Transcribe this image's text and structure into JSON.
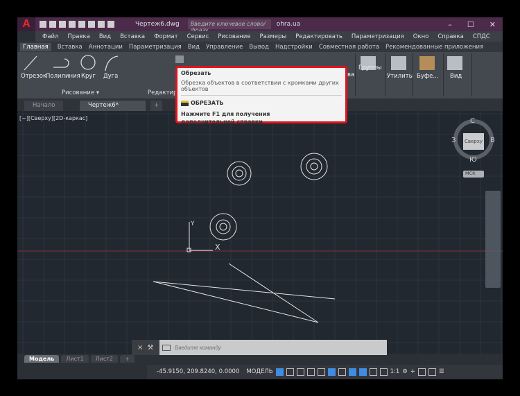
{
  "app": {
    "logo": "A",
    "document_title": "Чертеж6.dwg",
    "search_placeholder": "Введите ключевое слово/фразу",
    "user": "ohra.ua",
    "window_buttons": [
      "–",
      "☐",
      "✕"
    ]
  },
  "menu": [
    "Файл",
    "Правка",
    "Вид",
    "Вставка",
    "Формат",
    "Сервис",
    "Рисование",
    "Размеры",
    "Редактировать",
    "Параметризация",
    "Окно",
    "Справка",
    "СПДС"
  ],
  "ribbon_tabs": [
    "Главная",
    "Вставка",
    "Аннотации",
    "Параметризация",
    "Вид",
    "Управление",
    "Вывод",
    "Надстройки",
    "Совместная работа",
    "Рекомендованные приложения"
  ],
  "ribbon": {
    "draw_tools": [
      "Отрезок",
      "Полилиния",
      "Круг",
      "Дуга"
    ],
    "panels": [
      "Рисование ▾",
      "Редактиро"
    ],
    "right_tools": [
      "Группы",
      "Утилиты",
      "Буфе...",
      "Вид"
    ],
    "partial_label": "ва"
  },
  "doc_tabs": [
    "Начало",
    "Чертеж6*"
  ],
  "viewport_label": "[−][Сверху][2D-каркас]",
  "tooltip": {
    "title": "Обрезать",
    "description": "Обрезка объектов в соответствии с кромками других объектов",
    "command": "ОБРЕЗАТЬ",
    "help": "Нажмите F1 для получения",
    "help2": "дополнительной справки"
  },
  "viewcube": {
    "face": "Сверху",
    "n": "С",
    "s": "Ю",
    "w": "З",
    "e": "В",
    "ucs": "МСК"
  },
  "ucs_icon": {
    "x": "X",
    "y": "Y"
  },
  "command_line": {
    "placeholder": "Введите команду"
  },
  "layout_tabs": [
    "Модель",
    "Лист1",
    "Лист2",
    "+"
  ],
  "status": {
    "coords": "-45.9150, 209.8240, 0.0000",
    "mode": "МОДЕЛЬ",
    "scale": "1:1"
  },
  "colors": {
    "title_bar": "#4b2a4a",
    "canvas": "#212830",
    "tooltip_border": "#e0141e",
    "accent": "#3f8de0"
  }
}
